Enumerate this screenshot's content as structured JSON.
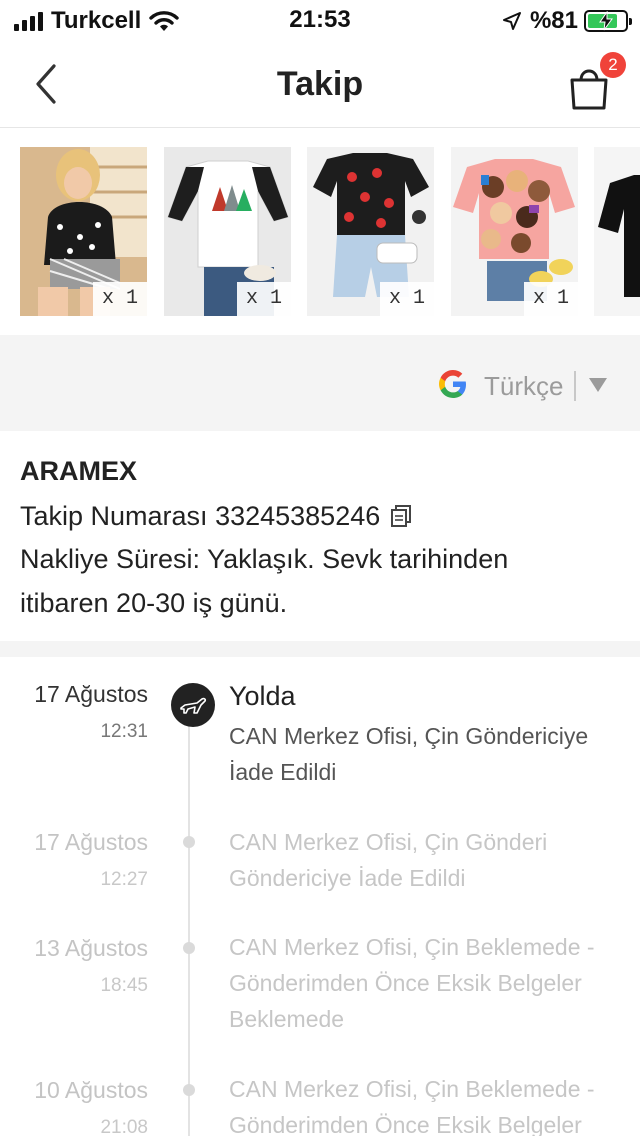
{
  "status_bar": {
    "carrier": "Turkcell",
    "time": "21:53",
    "battery": "%81",
    "battery_level": 0.81,
    "battery_color": "#34c759"
  },
  "header": {
    "title": "Takip",
    "back_icon": "chevron-left-icon",
    "cart_icon": "shopping-bag-icon",
    "cart_count": "2",
    "badge_color": "#f0433a"
  },
  "products": [
    {
      "qty": "x 1"
    },
    {
      "qty": "x 1"
    },
    {
      "qty": "x 1"
    },
    {
      "qty": "x 1"
    },
    {
      "qty": ""
    }
  ],
  "translate": {
    "provider_icon": "google-icon",
    "language": "Türkçe",
    "caret_icon": "caret-down-icon"
  },
  "shipment": {
    "carrier": "ARAMEX",
    "tracking_label": "Takip Numarası 33245385246",
    "copy_icon": "copy-icon",
    "shipping_time": "Nakliye Süresi: Yaklaşık. Sevk tarihinden itibaren 20-30 iş günü."
  },
  "timeline": [
    {
      "date": "17 Ağustos",
      "time": "12:31",
      "status": "Yolda",
      "status_icon": "airplane-icon",
      "description": "CAN Merkez Ofisi, Çin Göndericiye İade Edildi"
    },
    {
      "date": "17 Ağustos",
      "time": "12:27",
      "description": "CAN Merkez Ofisi, Çin Gönderi Göndericiye İade Edildi"
    },
    {
      "date": "13 Ağustos",
      "time": "18:45",
      "description": "CAN Merkez Ofisi, Çin Beklemede - Gönderimden Önce Eksik Belgeler Beklemede"
    },
    {
      "date": "10 Ağustos",
      "time": "21:08",
      "description": "CAN Merkez Ofisi, Çin Beklemede - Gönderimden Önce Eksik Belgeler"
    }
  ]
}
